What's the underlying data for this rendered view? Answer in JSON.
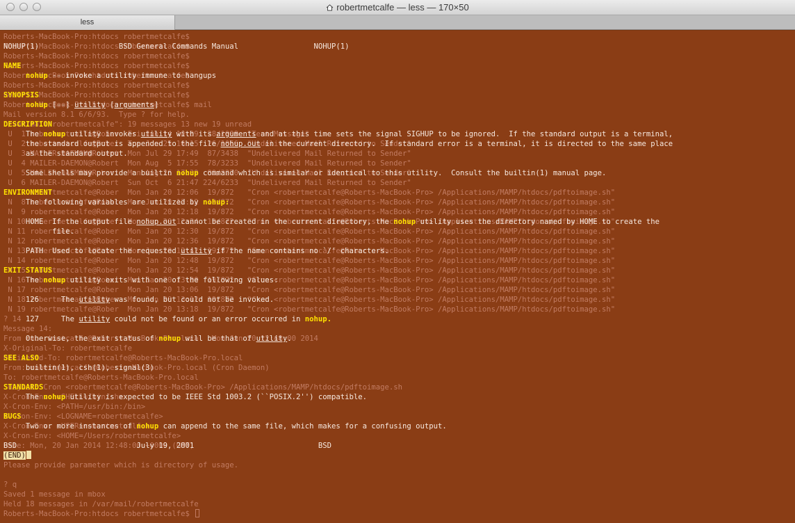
{
  "window": {
    "title": "robertmetcalfe — less — 170×50",
    "tab": "less",
    "traffic_lights": [
      "close-button",
      "minimize-button",
      "zoom-button"
    ],
    "title_icon": "home-icon"
  },
  "colors": {
    "terminal_bg": "#8a3d15",
    "foreground": "#f6e8df",
    "dim_text": "#c17b62",
    "bold_text": "#ffe100"
  },
  "bg_lines": [
    "Roberts-MacBook-Pro:htdocs robertmetcalfe$",
    "Roberts-MacBook-Pro:htdocs robertmetcalfe$",
    "Roberts-MacBook-Pro:htdocs robertmetcalfe$",
    "Roberts-MacBook-Pro:htdocs robertmetcalfe$",
    "Roberts-MacBook-Pro:htdocs robertmetcalfe$",
    "Roberts-MacBook-Pro:htdocs robertmetcalfe$",
    "Roberts-MacBook-Pro:htdocs robertmetcalfe$",
    "Roberts-MacBook-Pro:htdocs robertmetcalfe$ mail",
    "Mail version 8.1 6/6/93.  Type ? for help.",
    "\"/var/mail/robertmetcalfe\": 19 messages 13 new 19 unread",
    " U  1 robertmetcalfe@Rober  Fri Jun 14 10:09  28/1008  \"Test Message\"",
    " U  2 robertmetcalfe@Rober  Tue Jun 25 16:15  26/1066  \"Undelivered Mail Returned to Sender\"",
    " U  3 MAILER-DAEMON@Robert  Mon Jul 29 17:49  87/3438  \"Undelivered Mail Returned to Sender\"",
    " U  4 MAILER-DAEMON@Robert  Mon Aug  5 17:55  78/3233  \"Undelivered Mail Returned to Sender\"",
    " U  5 MAILER-DAEMON@Robert  Mon Aug 26 17:39  80/3270  \"Undelivered Mail Returned to Sender\"",
    " U  6 MAILER-DAEMON@Robert  Sun Oct  6 21:47 224/6233  \"Undelivered Mail Returned to Sender\"",
    " N  7 robertmetcalfe@Rober  Mon Jan 20 12:06  19/872   \"Cron <robertmetcalfe@Roberts-MacBook-Pro> /Applications/MAMP/htdocs/pdftoimage.sh\"",
    " N  8 robertmetcalfe@Rober  Mon Jan 20 12:12  19/872   \"Cron <robertmetcalfe@Roberts-MacBook-Pro> /Applications/MAMP/htdocs/pdftoimage.sh\"",
    " N  9 robertmetcalfe@Rober  Mon Jan 20 12:18  19/872   \"Cron <robertmetcalfe@Roberts-MacBook-Pro> /Applications/MAMP/htdocs/pdftoimage.sh\"",
    " N 10 robertmetcalfe@Rober  Mon Jan 20 12:24  19/872   \"Cron <robertmetcalfe@Roberts-MacBook-Pro> /Applications/MAMP/htdocs/pdftoimage.sh\"",
    " N 11 robertmetcalfe@Rober  Mon Jan 20 12:30  19/872   \"Cron <robertmetcalfe@Roberts-MacBook-Pro> /Applications/MAMP/htdocs/pdftoimage.sh\"",
    " N 12 robertmetcalfe@Rober  Mon Jan 20 12:36  19/872   \"Cron <robertmetcalfe@Roberts-MacBook-Pro> /Applications/MAMP/htdocs/pdftoimage.sh\"",
    " N 13 robertmetcalfe@Rober  Mon Jan 20 12:42  19/872   \"Cron <robertmetcalfe@Roberts-MacBook-Pro> /Applications/MAMP/htdocs/pdftoimage.sh\"",
    " N 14 robertmetcalfe@Rober  Mon Jan 20 12:48  19/872   \"Cron <robertmetcalfe@Roberts-MacBook-Pro> /Applications/MAMP/htdocs/pdftoimage.sh\"",
    " N 15 robertmetcalfe@Rober  Mon Jan 20 12:54  19/872   \"Cron <robertmetcalfe@Roberts-MacBook-Pro> /Applications/MAMP/htdocs/pdftoimage.sh\"",
    " N 16 robertmetcalfe@Rober  Mon Jan 20 13:00  19/872   \"Cron <robertmetcalfe@Roberts-MacBook-Pro> /Applications/MAMP/htdocs/pdftoimage.sh\"",
    " N 17 robertmetcalfe@Rober  Mon Jan 20 13:06  19/872   \"Cron <robertmetcalfe@Roberts-MacBook-Pro> /Applications/MAMP/htdocs/pdftoimage.sh\"",
    " N 18 robertmetcalfe@Rober  Mon Jan 20 13:12  19/872   \"Cron <robertmetcalfe@Roberts-MacBook-Pro> /Applications/MAMP/htdocs/pdftoimage.sh\"",
    " N 19 robertmetcalfe@Rober  Mon Jan 20 13:18  19/872   \"Cron <robertmetcalfe@Roberts-MacBook-Pro> /Applications/MAMP/htdocs/pdftoimage.sh\"",
    "? 14",
    "Message 14:",
    "From robertmetcalfe@Roberts-MacBook-Pro.local  Mon Jan 20 12:48:00 2014",
    "X-Original-To: robertmetcalfe",
    "Delivered-To: robertmetcalfe@Roberts-MacBook-Pro.local",
    "From: robertmetcalfe@Roberts-MacBook-Pro.local (Cron Daemon)",
    "To: robertmetcalfe@Roberts-MacBook-Pro.local",
    "Subject: Cron <robertmetcalfe@Roberts-MacBook-Pro> /Applications/MAMP/htdocs/pdftoimage.sh",
    "X-Cron-Env: <SHELL=/bin/sh>",
    "X-Cron-Env: <PATH=/usr/bin:/bin>",
    "X-Cron-Env: <LOGNAME=robertmetcalfe>",
    "X-Cron-Env: <USER=robertmetcalfe>",
    "X-Cron-Env: <HOME=/Users/robertmetcalfe>",
    "Date: Mon, 20 Jan 2014 12:48:00 +0000 (GMT)",
    "",
    "Please provide parameter which is directory of usage.",
    "",
    "? q",
    "Saved 1 message in mbox",
    "Held 18 messages in /var/mail/robertmetcalfe",
    "Roberts-MacBook-Pro:htdocs robertmetcalfe$ "
  ],
  "man": {
    "header": "NOHUP(1)                  BSD General Commands Manual                 NOHUP(1)",
    "name_heading": "NAME",
    "name_pre": "     ",
    "name_cmd": "nohup",
    "name_rest": " -- invoke a utility immune to hangups",
    "synopsis_heading": "SYNOPSIS",
    "synopsis_pre": "     ",
    "synopsis_cmd": "nohup",
    "synopsis_opt": " [--] ",
    "synopsis_arg1": "utility",
    "synopsis_bracket_open": " [",
    "synopsis_arg2": "arguments",
    "synopsis_bracket_close": "]",
    "description_heading": "DESCRIPTION",
    "desc_p1_pre": "     The ",
    "desc_p1_cmd": "nohup",
    "desc_p1_mid1": " utility invokes ",
    "desc_p1_u1": "utility",
    "desc_p1_mid2": " with its ",
    "desc_p1_u2": "arguments",
    "desc_p1_end": " and at this time sets the signal SIGHUP to be ignored.  If the standard output is a terminal,",
    "desc_p1_l2_pre": "     the standard output is appended to the file ",
    "desc_p1_l2_u": "nohup.out",
    "desc_p1_l2_end": " in the current directory.  If standard error is a terminal, it is directed to the same place",
    "desc_p1_l3": "     as the standard output.",
    "desc_p2_pre": "     Some shells may provide a builtin ",
    "desc_p2_cmd": "nohup",
    "desc_p2_end": " command which is similar or identical to this utility.  Consult the builtin(1) manual page.",
    "environment_heading": "ENVIRONMENT",
    "env_intro_pre": "     The following variables are utilized by ",
    "env_intro_cmd": "nohup:",
    "env_home_pre": "     HOME  If the output file ",
    "env_home_u": "nohup.out",
    "env_home_mid": " cannot be created in the current directory, the ",
    "env_home_cmd": "nohup",
    "env_home_end": " utility uses the directory named by HOME to create the",
    "env_home_l2": "           file.",
    "env_path_pre": "     PATH  Used to locate the requested ",
    "env_path_u": "utility",
    "env_path_end": " if the name contains no `/' characters.",
    "exit_heading": "EXIT STATUS",
    "exit_intro_pre": "     The ",
    "exit_intro_cmd": "nohup",
    "exit_intro_end": " utility exits with one of the following values:",
    "exit_126_pre": "     126     The ",
    "exit_126_u": "utility",
    "exit_126_end": " was found, but could not be invoked.",
    "exit_127_pre": "     127     The ",
    "exit_127_u": "utility",
    "exit_127_mid": " could not be found or an error occurred in ",
    "exit_127_cmd": "nohup.",
    "exit_other_pre": "     Otherwise, the exit status of ",
    "exit_other_cmd": "nohup",
    "exit_other_mid": " will be that of ",
    "exit_other_u": "utility",
    "exit_other_end": ".",
    "see_also_heading": "SEE ALSO",
    "see_also_text": "     builtin(1), csh(1), signal(3)",
    "standards_heading": "STANDARDS",
    "std_pre": "     The ",
    "std_cmd": "nohup",
    "std_end": " utility is expected to be IEEE Std 1003.2 (``POSIX.2'') compatible.",
    "bugs_heading": "BUGS",
    "bugs_pre": "     Two or more instances of ",
    "bugs_cmd": "nohup",
    "bugs_end": " can append to the same file, which makes for a confusing output.",
    "footer": "BSD                           July 19, 2001                            BSD",
    "end_marker": "(END)"
  }
}
